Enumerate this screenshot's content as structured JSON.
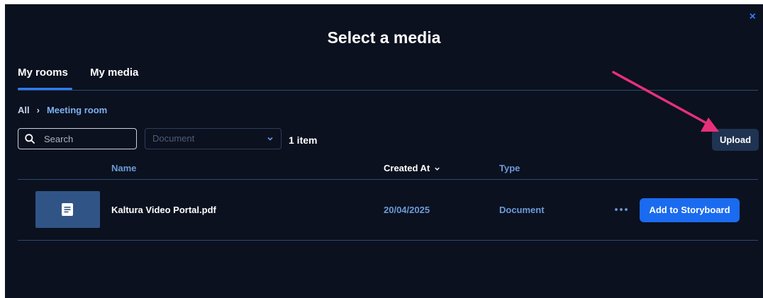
{
  "modal": {
    "title": "Select a media",
    "close_glyph": "×"
  },
  "tabs": [
    {
      "label": "My rooms",
      "active": true
    },
    {
      "label": "My media",
      "active": false
    }
  ],
  "breadcrumb": {
    "root": "All",
    "separator": "›",
    "current": "Meeting room"
  },
  "toolbar": {
    "search_placeholder": "Search",
    "search_value": "",
    "type_filter": "Document",
    "item_count": "1 item",
    "upload_label": "Upload"
  },
  "table": {
    "columns": [
      "Name",
      "Created At",
      "Type"
    ],
    "sorted_column": "Created At",
    "rows": [
      {
        "name": "Kaltura Video Portal.pdf",
        "created_at": "20/04/2025",
        "type": "Document",
        "action_label": "Add to Storyboard",
        "thumbnail_icon": "document-icon"
      }
    ]
  },
  "colors": {
    "background": "#0b111f",
    "accent": "#2f7df6",
    "primary_button": "#1a6bef",
    "annotation_arrow": "#e8307a"
  }
}
